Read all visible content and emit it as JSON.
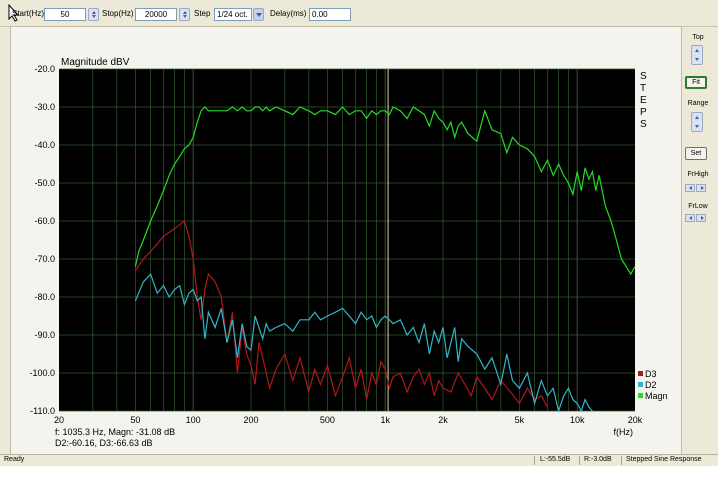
{
  "toolbar": {
    "start_label": "Start(Hz)",
    "start_value": "50",
    "stop_label": "Stop(Hz)",
    "stop_value": "20000",
    "step_label": "Step",
    "step_value": "1/24 oct.",
    "delay_label": "Delay(ms)",
    "delay_value": "0.00"
  },
  "side": {
    "top_label": "Top",
    "fit_label": "Fit",
    "range_label": "Range",
    "set_label": "Set",
    "frhigh_label": "FrHigh",
    "frlow_label": "FrLow"
  },
  "readout": {
    "line1": "f: 1035.3 Hz, Magn: -31.08 dB",
    "line2": "D2:-60.16, D3:-66.63 dB"
  },
  "status": {
    "left": "Ready",
    "l_value": "L:-55.5dB",
    "r_value": "R:-3.0dB",
    "mode": "Stepped Sine Response"
  },
  "colors": {
    "plot_bg": "#000000",
    "grid": "#2f5a2f",
    "magn": "#22dd22",
    "d2": "#33b5c8",
    "d3": "#b01818",
    "cursor": "#d8d8a0"
  },
  "chart_data": {
    "type": "line",
    "title": "Magnitude dBV",
    "xlabel": "f(Hz)",
    "ylabel": "",
    "xscale": "log",
    "xlim": [
      20,
      20000
    ],
    "ylim": [
      -110,
      -20
    ],
    "grid": true,
    "legend_position": "bottom-right",
    "right_label": "STEPS",
    "x_ticks": [
      {
        "v": 20,
        "label": "20"
      },
      {
        "v": 50,
        "label": "50"
      },
      {
        "v": 100,
        "label": "100"
      },
      {
        "v": 200,
        "label": "200"
      },
      {
        "v": 500,
        "label": "500"
      },
      {
        "v": 1000,
        "label": "1k"
      },
      {
        "v": 2000,
        "label": "2k"
      },
      {
        "v": 5000,
        "label": "5k"
      },
      {
        "v": 10000,
        "label": "10k"
      },
      {
        "v": 20000,
        "label": "20k"
      }
    ],
    "y_ticks": [
      {
        "v": -20,
        "label": "-20.0"
      },
      {
        "v": -30,
        "label": "-30.0"
      },
      {
        "v": -40,
        "label": "-40.0"
      },
      {
        "v": -50,
        "label": "-50.0"
      },
      {
        "v": -60,
        "label": "-60.0"
      },
      {
        "v": -70,
        "label": "-70.0"
      },
      {
        "v": -80,
        "label": "-80.0"
      },
      {
        "v": -90,
        "label": "-90.0"
      },
      {
        "v": -100,
        "label": "-100.0"
      },
      {
        "v": -110,
        "label": "-110.0"
      }
    ],
    "cursor_x": 1035.3,
    "series": [
      {
        "name": "Magn",
        "color": "#22dd22",
        "x": [
          50,
          52,
          55,
          60,
          65,
          70,
          75,
          80,
          85,
          90,
          95,
          100,
          105,
          110,
          115,
          120,
          130,
          140,
          150,
          160,
          170,
          180,
          190,
          200,
          210,
          220,
          230,
          240,
          250,
          270,
          300,
          330,
          360,
          400,
          430,
          460,
          500,
          550,
          600,
          650,
          700,
          750,
          800,
          850,
          900,
          950,
          1000,
          1050,
          1100,
          1200,
          1300,
          1400,
          1500,
          1600,
          1700,
          1800,
          1900,
          2000,
          2100,
          2200,
          2300,
          2400,
          2500,
          2700,
          3000,
          3300,
          3600,
          4000,
          4300,
          4600,
          5000,
          5500,
          6000,
          6500,
          7000,
          7500,
          8000,
          8500,
          9000,
          9500,
          10000,
          10500,
          11000,
          11500,
          12000,
          12500,
          13000,
          14000,
          15000,
          16000,
          17000,
          18000,
          19000,
          20000
        ],
        "y": [
          -72,
          -68,
          -65,
          -60,
          -56,
          -52,
          -48,
          -45,
          -43,
          -41,
          -40,
          -38,
          -34,
          -31,
          -30,
          -31,
          -31,
          -31,
          -31,
          -30,
          -31,
          -30,
          -31,
          -31,
          -30,
          -30,
          -31,
          -30,
          -31,
          -30,
          -31,
          -32,
          -30,
          -31,
          -32,
          -31,
          -31,
          -32,
          -30,
          -32,
          -31,
          -31,
          -33,
          -31,
          -32,
          -31,
          -31,
          -32,
          -30,
          -31,
          -33,
          -30,
          -31,
          -32,
          -35,
          -31,
          -33,
          -34,
          -36,
          -34,
          -38,
          -35,
          -34,
          -37,
          -39,
          -31,
          -36,
          -37,
          -42,
          -38,
          -40,
          -41,
          -43,
          -47,
          -44,
          -48,
          -45,
          -48,
          -50,
          -53,
          -47,
          -52,
          -46,
          -49,
          -47,
          -52,
          -48,
          -56,
          -60,
          -65,
          -70,
          -72,
          -74,
          -72
        ]
      },
      {
        "name": "D2",
        "color": "#33b5c8",
        "x": [
          50,
          55,
          60,
          65,
          70,
          75,
          80,
          85,
          90,
          95,
          100,
          105,
          110,
          115,
          120,
          130,
          140,
          150,
          160,
          170,
          180,
          190,
          200,
          210,
          220,
          230,
          240,
          250,
          270,
          300,
          330,
          360,
          400,
          430,
          460,
          500,
          550,
          600,
          650,
          700,
          750,
          800,
          850,
          900,
          950,
          1000,
          1050,
          1100,
          1200,
          1300,
          1400,
          1500,
          1600,
          1700,
          1800,
          1900,
          2000,
          2100,
          2200,
          2300,
          2400,
          2500,
          2700,
          3000,
          3300,
          3600,
          4000,
          4300,
          4600,
          5000,
          5500,
          6000,
          6500,
          7000,
          7500,
          8000,
          8500,
          9000,
          9500,
          10000,
          10500,
          11000,
          11500,
          12000
        ],
        "y": [
          -81,
          -76,
          -74,
          -79,
          -77,
          -80,
          -78,
          -77,
          -82,
          -79,
          -78,
          -81,
          -80,
          -91,
          -84,
          -88,
          -83,
          -92,
          -86,
          -96,
          -87,
          -93,
          -94,
          -85,
          -88,
          -91,
          -87,
          -89,
          -88,
          -87,
          -89,
          -86,
          -86,
          -84,
          -86,
          -85,
          -84,
          -83,
          -85,
          -87,
          -84,
          -86,
          -85,
          -88,
          -86,
          -85,
          -86,
          -87,
          -86,
          -90,
          -88,
          -92,
          -87,
          -95,
          -89,
          -92,
          -88,
          -96,
          -92,
          -88,
          -97,
          -91,
          -93,
          -95,
          -99,
          -96,
          -103,
          -95,
          -102,
          -104,
          -100,
          -108,
          -102,
          -106,
          -104,
          -110,
          -106,
          -104,
          -107,
          -108,
          -110,
          -107,
          -109,
          -110
        ]
      },
      {
        "name": "D3",
        "color": "#b01818",
        "x": [
          50,
          55,
          60,
          65,
          70,
          75,
          80,
          85,
          90,
          95,
          100,
          105,
          110,
          115,
          120,
          130,
          140,
          150,
          160,
          170,
          180,
          190,
          200,
          210,
          220,
          230,
          240,
          250,
          270,
          300,
          330,
          360,
          400,
          430,
          460,
          500,
          550,
          600,
          650,
          700,
          750,
          800,
          850,
          900,
          950,
          1000,
          1050,
          1100,
          1200,
          1300,
          1400,
          1500,
          1600,
          1700,
          1800,
          1900,
          2000,
          2200,
          2400,
          2600,
          2800,
          3000,
          3300,
          3600,
          4000,
          4500,
          5000,
          5500,
          6000,
          6500,
          7000
        ],
        "y": [
          -73,
          -70,
          -68,
          -66,
          -64,
          -63,
          -62,
          -61,
          -60,
          -64,
          -70,
          -80,
          -86,
          -78,
          -74,
          -76,
          -80,
          -92,
          -84,
          -100,
          -88,
          -95,
          -98,
          -103,
          -92,
          -96,
          -100,
          -104,
          -99,
          -95,
          -102,
          -96,
          -105,
          -99,
          -103,
          -98,
          -106,
          -101,
          -96,
          -104,
          -99,
          -107,
          -100,
          -103,
          -97,
          -99,
          -104,
          -101,
          -100,
          -105,
          -101,
          -99,
          -103,
          -100,
          -106,
          -102,
          -104,
          -105,
          -100,
          -103,
          -106,
          -101,
          -104,
          -107,
          -102,
          -105,
          -108,
          -104,
          -107,
          -106,
          -109
        ]
      }
    ]
  }
}
